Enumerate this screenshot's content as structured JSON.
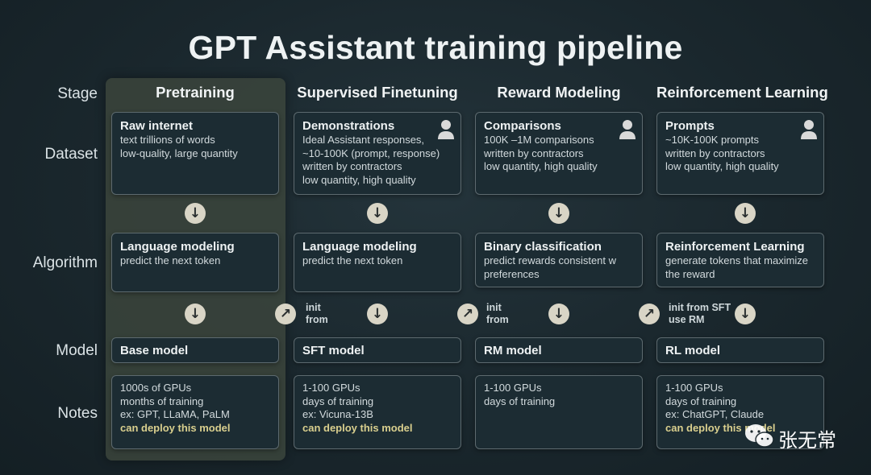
{
  "title": "GPT Assistant training pipeline",
  "row_labels": {
    "stage": "Stage",
    "dataset": "Dataset",
    "algorithm": "Algorithm",
    "model": "Model",
    "notes": "Notes"
  },
  "columns": [
    {
      "header": "Pretraining",
      "dataset": {
        "title": "Raw internet",
        "lines": [
          "text trillions of words",
          "low-quality, large quantity"
        ]
      },
      "algorithm": {
        "title": "Language modeling",
        "lines": [
          "predict the next token"
        ]
      },
      "model": "Base model",
      "notes": {
        "lines": [
          "1000s of GPUs",
          "months of training",
          "ex: GPT, LLaMA, PaLM"
        ],
        "highlight": "can deploy this model"
      }
    },
    {
      "header": "Supervised Finetuning",
      "dataset": {
        "title": "Demonstrations",
        "lines": [
          "Ideal Assistant responses,",
          "~10-100K (prompt, response)",
          "written by contractors",
          "low quantity, high quality"
        ]
      },
      "algorithm": {
        "title": "Language modeling",
        "lines": [
          "predict the next token"
        ]
      },
      "model": "SFT model",
      "init": [
        "init",
        "from"
      ],
      "notes": {
        "lines": [
          "1-100 GPUs",
          "days of training",
          "ex: Vicuna-13B"
        ],
        "highlight": "can deploy this model"
      }
    },
    {
      "header": "Reward Modeling",
      "dataset": {
        "title": "Comparisons",
        "lines": [
          "100K –1M comparisons",
          "written by contractors",
          "low quantity, high quality"
        ]
      },
      "algorithm": {
        "title": "Binary classification",
        "lines": [
          "predict rewards consistent w",
          "preferences"
        ]
      },
      "model": "RM model",
      "init": [
        "init",
        "from"
      ],
      "notes": {
        "lines": [
          "1-100 GPUs",
          "days of training"
        ]
      }
    },
    {
      "header": "Reinforcement Learning",
      "dataset": {
        "title": "Prompts",
        "lines": [
          "~10K-100K prompts",
          "written by contractors",
          "low quantity, high quality"
        ]
      },
      "algorithm": {
        "title": "Reinforcement Learning",
        "lines": [
          "generate tokens that maximize",
          "the reward"
        ]
      },
      "model": "RL model",
      "init": [
        "init from SFT",
        "use RM"
      ],
      "notes": {
        "lines": [
          "1-100 GPUs",
          "days of training",
          "ex: ChatGPT, Claude"
        ],
        "highlight": "can deploy this model"
      }
    }
  ],
  "watermark": "张无常",
  "icons": {
    "down_arrow": "arrow-down-icon",
    "diagonal_arrow": "arrow-up-right-icon",
    "person": "person-icon",
    "watermark": "wechat-icon"
  }
}
